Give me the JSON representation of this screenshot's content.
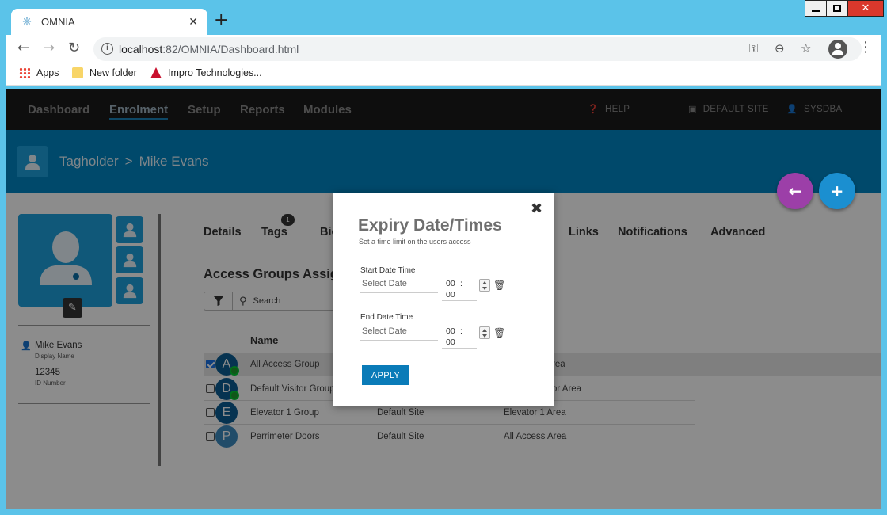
{
  "browser": {
    "tab_title": "OMNIA",
    "url_host": "localhost",
    "url_path": ":82/OMNIA/Dashboard.html",
    "bookmarks": [
      {
        "label": "Apps",
        "icon": "apps-grid-icon"
      },
      {
        "label": "New folder",
        "icon": "folder-icon"
      },
      {
        "label": "Impro Technologies...",
        "icon": "impro-logo-icon"
      }
    ]
  },
  "nav": {
    "items": [
      "Dashboard",
      "Enrolment",
      "Setup",
      "Reports",
      "Modules"
    ],
    "active": "Enrolment",
    "help": "HELP",
    "site": "DEFAULT SITE",
    "user": "SYSDBA"
  },
  "header": {
    "breadcrumb_root": "Tagholder",
    "breadcrumb_sep": ">",
    "breadcrumb_current": "Mike Evans"
  },
  "profile": {
    "display_name": "Mike Evans",
    "display_name_label": "Display Name",
    "id_number": "12345",
    "id_number_label": "ID Number"
  },
  "tabs": {
    "details": "Details",
    "tags": "Tags",
    "tags_badge": "1",
    "bio": "Bio",
    "links": "Links",
    "notifications": "Notifications",
    "advanced": "Advanced"
  },
  "access_groups": {
    "title": "Access Groups Assig",
    "search_placeholder": "Search",
    "column_name": "Name",
    "rows": [
      {
        "letter": "A",
        "name": "All Access Group",
        "site": "",
        "area": "rea",
        "checked": true,
        "synced": true
      },
      {
        "letter": "D",
        "name": "Default Visitor Group",
        "site": "",
        "area": "or Area",
        "checked": false,
        "synced": true
      },
      {
        "letter": "E",
        "name": "Elevator 1 Group",
        "site": "Default Site",
        "area": "Elevator 1 Area",
        "checked": false,
        "synced": false
      },
      {
        "letter": "P",
        "name": "Perrimeter Doors",
        "site": "Default Site",
        "area": "All Access Area",
        "checked": false,
        "synced": false
      }
    ]
  },
  "modal": {
    "title": "Expiry Date/Times",
    "subtitle": "Set a time limit on the users access",
    "start_label": "Start Date Time",
    "end_label": "End Date Time",
    "date_placeholder": "Select Date",
    "hour": "00",
    "colon": ":",
    "minute": "00",
    "apply_label": "APPLY"
  },
  "colors": {
    "accent": "#0085c4",
    "nav_bg": "#1a1a1a",
    "back_fab": "#9c3fa8",
    "add_fab": "#1b8fd0"
  }
}
